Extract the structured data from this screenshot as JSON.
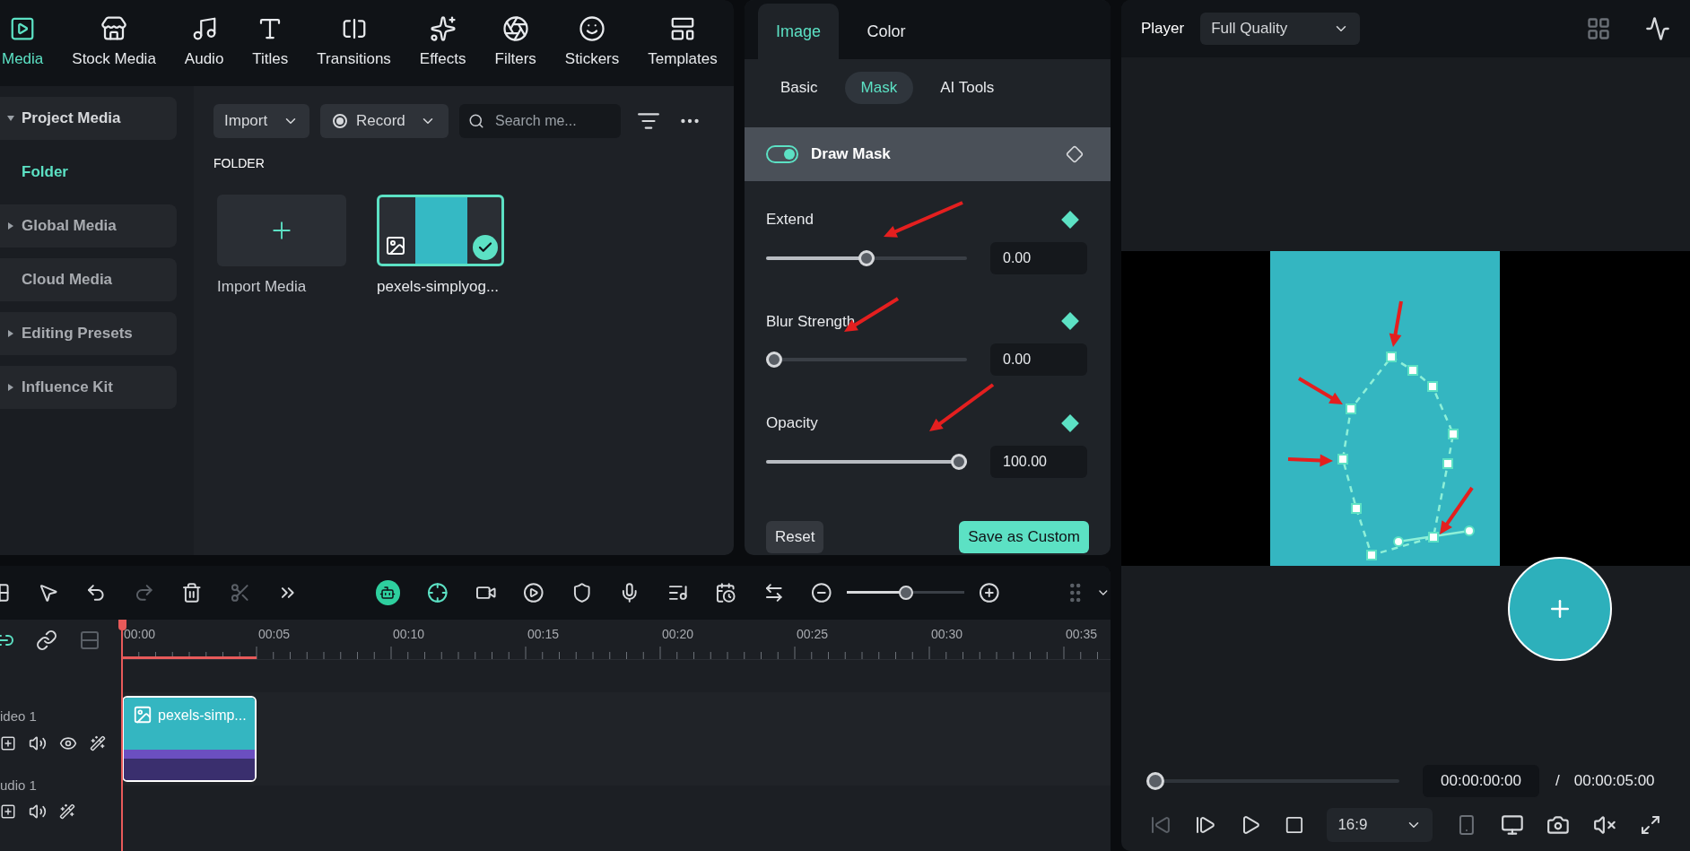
{
  "nav_tabs": [
    {
      "label": "Media",
      "selected": true
    },
    {
      "label": "Stock Media",
      "selected": false
    },
    {
      "label": "Audio",
      "selected": false
    },
    {
      "label": "Titles",
      "selected": false
    },
    {
      "label": "Transitions",
      "selected": false
    },
    {
      "label": "Effects",
      "selected": false
    },
    {
      "label": "Filters",
      "selected": false
    },
    {
      "label": "Stickers",
      "selected": false
    },
    {
      "label": "Templates",
      "selected": false
    }
  ],
  "sidebar": {
    "items": [
      {
        "kind": "expandable",
        "label": "Project Media",
        "expanded": true,
        "selected": false
      },
      {
        "kind": "child",
        "label": "Folder",
        "selected": true
      },
      {
        "kind": "expandable",
        "label": "Global Media",
        "expanded": false,
        "selected": false
      },
      {
        "kind": "plain",
        "label": "Cloud Media",
        "selected": false
      },
      {
        "kind": "expandable",
        "label": "Editing Presets",
        "expanded": false,
        "selected": false
      },
      {
        "kind": "expandable",
        "label": "Influence Kit",
        "expanded": false,
        "selected": false
      }
    ]
  },
  "media_toolbar": {
    "import": "Import",
    "record": "Record",
    "search": {
      "placeholder": "Search me..."
    }
  },
  "folder_heading": "FOLDER",
  "media_items": [
    {
      "kind": "import",
      "label": "Import Media",
      "selected": false
    },
    {
      "kind": "clip",
      "label": "pexels-simplyog...",
      "selected": true
    }
  ],
  "properties": {
    "tabs": [
      {
        "label": "Image",
        "selected": true
      },
      {
        "label": "Color",
        "selected": false
      }
    ],
    "subtabs": [
      {
        "label": "Basic",
        "selected": false
      },
      {
        "label": "Mask",
        "selected": true
      },
      {
        "label": "AI Tools",
        "selected": false
      }
    ],
    "draw_mask": {
      "label": "Draw Mask",
      "on": true
    },
    "sliders": [
      {
        "label": "Extend",
        "level": 0.5,
        "value": "0.00"
      },
      {
        "label": "Blur Strength",
        "level": 0,
        "value": "0.00"
      },
      {
        "label": "Opacity",
        "level": 1,
        "value": "100.00"
      }
    ],
    "reset": "Reset",
    "save": "Save as Custom"
  },
  "player": {
    "label": "Player",
    "quality": "Full Quality",
    "level": 0,
    "current_time": "00:00:00:00",
    "separator": "/",
    "total_time": "00:00:05:00",
    "aspect": "16:9"
  },
  "timeline": {
    "zoom": {
      "level": 0.5
    },
    "ruler": [
      "00:00",
      "00:05",
      "00:10",
      "00:15",
      "00:20",
      "00:25",
      "00:30",
      "00:35"
    ],
    "tracks": [
      {
        "kind": "video",
        "label": "ideo 1"
      },
      {
        "kind": "audio",
        "label": "udio 1"
      }
    ],
    "clip": {
      "label": "pexels-simp..."
    }
  }
}
